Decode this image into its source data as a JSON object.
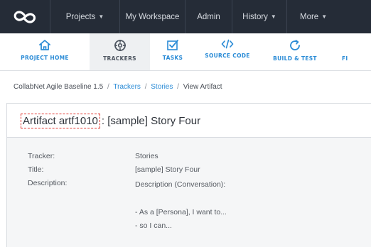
{
  "nav": {
    "logo_icon": "collabnet-logo-icon",
    "items": [
      {
        "label": "Projects",
        "dropdown": true
      },
      {
        "label": "My Workspace",
        "dropdown": false
      },
      {
        "label": "Admin",
        "dropdown": false
      },
      {
        "label": "History",
        "dropdown": true
      },
      {
        "label": "More",
        "dropdown": true
      }
    ]
  },
  "tools": [
    {
      "label": "PROJECT HOME",
      "icon": "home-icon",
      "active": false
    },
    {
      "label": "TRACKERS",
      "icon": "crosshair-icon",
      "active": true
    },
    {
      "label": "TASKS",
      "icon": "checkbox-icon",
      "active": false
    },
    {
      "label": "SOURCE CODE",
      "icon": "code-icon",
      "active": false
    },
    {
      "label": "BUILD & TEST",
      "icon": "refresh-icon",
      "active": false
    },
    {
      "label": "FI",
      "icon": "",
      "active": false
    }
  ],
  "breadcrumb": {
    "project": "CollabNet Agile Baseline 1.5",
    "trackers": "Trackers",
    "stories": "Stories",
    "current": "View Artifact",
    "separator": "/"
  },
  "artifact": {
    "id_label": "Artifact artf1010",
    "rest_label": ": [sample] Story Four"
  },
  "fields": {
    "tracker_label": "Tracker:",
    "tracker_value": "Stories",
    "title_label": "Title:",
    "title_value": "[sample] Story Four",
    "description_label": "Description:",
    "description_heading": "Description (Conversation):",
    "description_line1": "- As a [Persona],  I want to...",
    "description_line2": "- so I can..."
  },
  "colors": {
    "nav_bg": "#252c37",
    "accent": "#2a8bd6",
    "highlight_box": "#e0312b"
  }
}
